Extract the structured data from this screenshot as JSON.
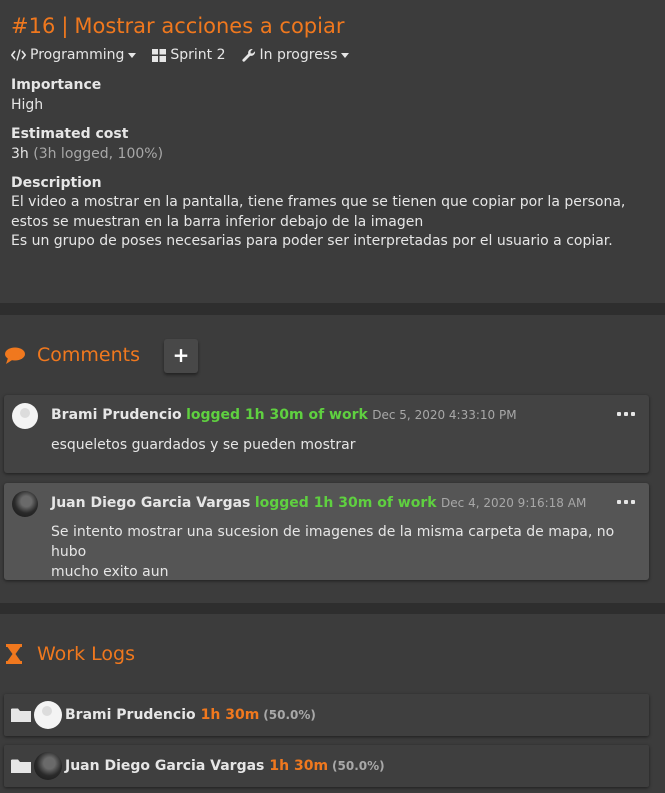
{
  "task": {
    "number": "#16",
    "separator": "|",
    "title": "Mostrar acciones a copiar",
    "type": "Programming",
    "sprint": "Sprint 2",
    "status": "In progress",
    "importance_label": "Importance",
    "importance_value": "High",
    "cost_label": "Estimated cost",
    "cost_value": "3h",
    "cost_detail": "(3h logged, 100%)",
    "description_label": "Description",
    "description_lines": [
      "El video a mostrar en la pantalla, tiene frames que se tienen que copiar por la persona,",
      "estos se muestran en la barra inferior debajo de la imagen",
      "Es un grupo de poses necesarias para poder ser interpretadas por el usuario a copiar."
    ]
  },
  "comments_section": {
    "title": "Comments",
    "add_label": "+",
    "comments": [
      {
        "author": "Brami Prudencio",
        "logged": "logged 1h 30m of work",
        "date": "Dec 5, 2020 4:33:10 PM",
        "body_lines": [
          "esqueletos guardados y se pueden mostrar"
        ]
      },
      {
        "author": "Juan Diego Garcia Vargas",
        "logged": "logged 1h 30m of work",
        "date": "Dec 4, 2020 9:16:18 AM",
        "body_lines": [
          "Se intento mostrar una sucesion de imagenes de la misma carpeta de mapa, no hubo",
          "mucho exito aun"
        ]
      }
    ]
  },
  "worklogs_section": {
    "title": "Work Logs",
    "logs": [
      {
        "name": "Brami Prudencio",
        "hours": "1h 30m",
        "percent": "(50.0%)"
      },
      {
        "name": "Juan Diego Garcia Vargas",
        "hours": "1h 30m",
        "percent": "(50.0%)"
      }
    ]
  },
  "colors": {
    "background": "#3c3c3c",
    "accent": "#f0781e",
    "logged_green": "#5fd040",
    "comment_card": "#434343",
    "comment_card_highlight": "#555555"
  }
}
